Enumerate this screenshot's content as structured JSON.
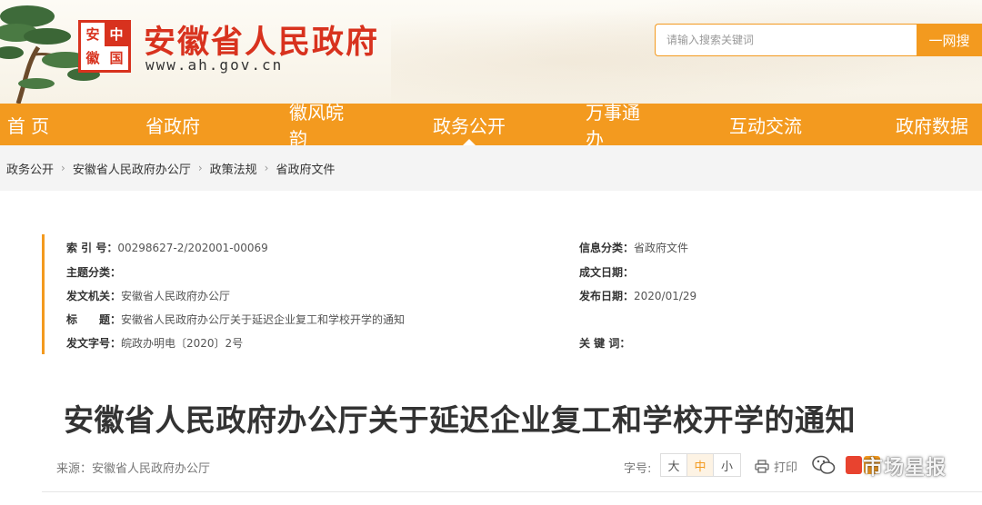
{
  "header": {
    "seal_chars": [
      "安",
      "中",
      "徽",
      "国"
    ],
    "title": "安徽省人民政府",
    "url": "www.ah.gov.cn",
    "search_placeholder": "请输入搜索关键词",
    "search_button": "一网搜"
  },
  "nav": {
    "items": [
      {
        "label": "首 页",
        "active": false
      },
      {
        "label": "省政府",
        "active": false
      },
      {
        "label": "徽风皖韵",
        "active": false
      },
      {
        "label": "政务公开",
        "active": true
      },
      {
        "label": "万事通办",
        "active": false
      },
      {
        "label": "互动交流",
        "active": false
      },
      {
        "label": "政府数据",
        "active": false
      }
    ]
  },
  "breadcrumb": {
    "items": [
      "政务公开",
      "安徽省人民政府办公厅",
      "政策法规",
      "省政府文件"
    ],
    "separator": "›"
  },
  "info": {
    "index_label": "索 引 号：",
    "index_value": "00298627-2/202001-00069",
    "category_label": "信息分类：",
    "category_value": "省政府文件",
    "topic_label": "主题分类：",
    "topic_value": "",
    "created_label": "成文日期：",
    "created_value": "",
    "issuer_label": "发文机关：",
    "issuer_value": "安徽省人民政府办公厅",
    "published_label": "发布日期：",
    "published_value": "2020/01/29",
    "title_label": "标　　题：",
    "title_value": "安徽省人民政府办公厅关于延迟企业复工和学校开学的通知",
    "docno_label": "发文字号：",
    "docno_value": "皖政办明电〔2020〕2号",
    "keywords_label": "关 键 词：",
    "keywords_value": ""
  },
  "article": {
    "title": "安徽省人民政府办公厅关于延迟企业复工和学校开学的通知",
    "source": "来源：安徽省人民政府办公厅",
    "fontsize_label": "字号:",
    "fontsize_options": [
      "大",
      "中",
      "小"
    ],
    "fontsize_selected": "中",
    "print_label": "打印"
  },
  "watermark": "市场星报",
  "colors": {
    "brand_red": "#d8321e",
    "nav_orange": "#f39a1f"
  }
}
